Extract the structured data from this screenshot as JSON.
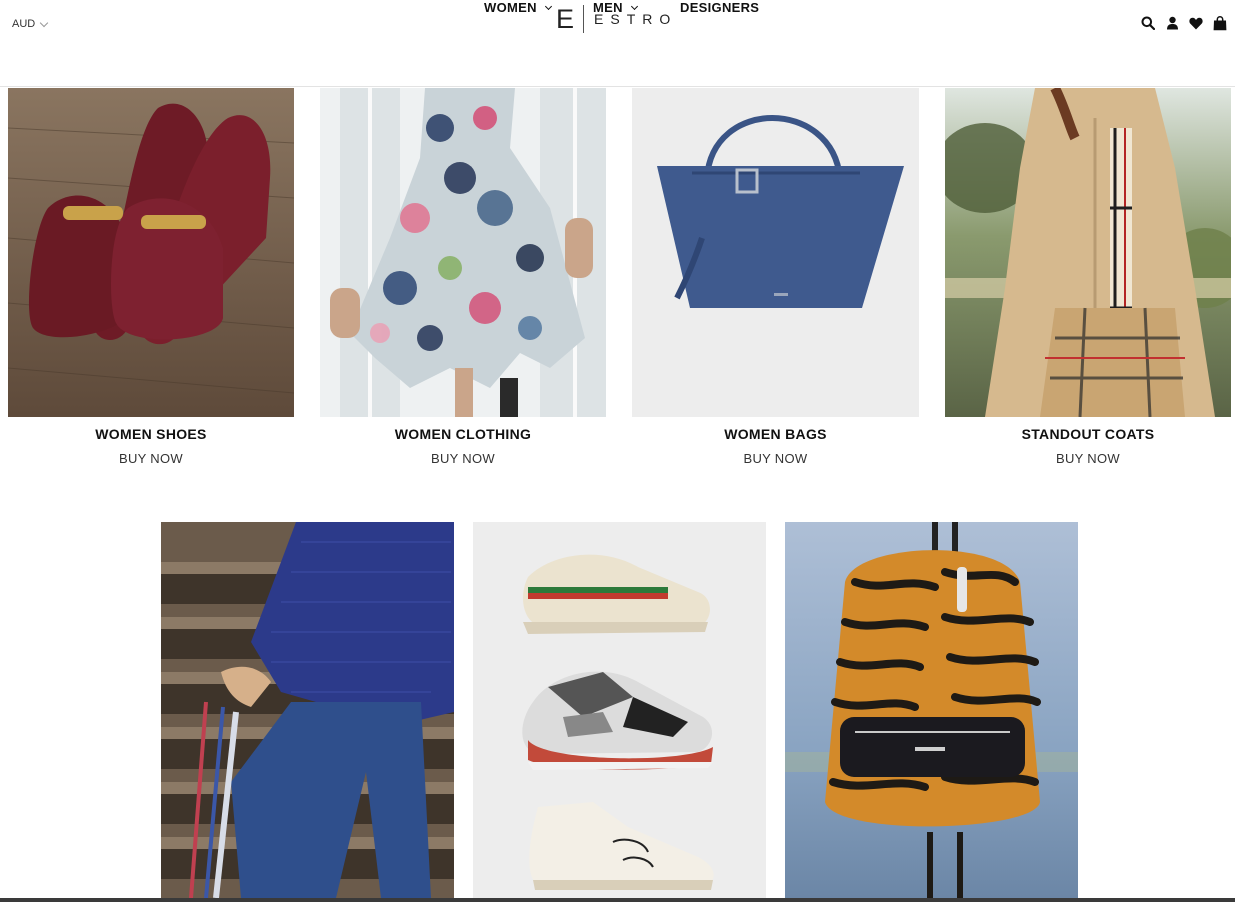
{
  "header": {
    "currency": "AUD",
    "logo_letter": "E",
    "logo_word": "ESTRO",
    "nav": [
      {
        "label": "WOMEN",
        "has_dropdown": true
      },
      {
        "label": "MEN",
        "has_dropdown": true
      },
      {
        "label": "DESIGNERS",
        "has_dropdown": false
      }
    ],
    "icons": [
      "search-icon",
      "account-icon",
      "wishlist-heart-icon",
      "shopping-bag-icon"
    ]
  },
  "categories": [
    {
      "title": "WOMEN SHOES",
      "cta": "BUY NOW",
      "image": "burgundy-loafers-photo"
    },
    {
      "title": "WOMEN CLOTHING",
      "cta": "BUY NOW",
      "image": "floral-dress-photo"
    },
    {
      "title": "WOMEN BAGS",
      "cta": "BUY NOW",
      "image": "blue-tote-bag-photo"
    },
    {
      "title": "STANDOUT COATS",
      "cta": "BUY NOW",
      "image": "trench-coat-photo"
    }
  ],
  "promos": [
    {
      "image": "blue-sweater-jeans-photo"
    },
    {
      "image": "sneakers-trio-photo"
    },
    {
      "image": "tiger-print-backpack-photo"
    }
  ],
  "colors": {
    "text": "#111111",
    "muted": "#333333",
    "divider": "#e3e3e3"
  }
}
